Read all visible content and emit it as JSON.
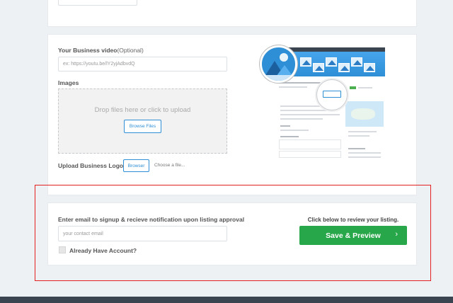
{
  "video_section": {
    "label": "Your Business video",
    "label_optional": "(Optional)",
    "placeholder": "ex: https://youtu.be/lY2yjAdbvdQ"
  },
  "images_section": {
    "label": "Images",
    "drop_text": "Drop files here or click to upload",
    "browse_label": "Browse Files"
  },
  "logo_section": {
    "label": "Upload Business Logo",
    "browser_label": "Browser",
    "choose_file": "Choose a file..."
  },
  "signup_section": {
    "label": "Enter email to signup & recieve notification upon listing approval",
    "email_placeholder": "your contact email",
    "already_account": "Already Have Account?"
  },
  "review_section": {
    "prompt": "Click below to review your listing.",
    "save_label": "Save & Preview",
    "chevron": "›"
  },
  "colors": {
    "accent_blue": "#2e8fd6",
    "save_green": "#27a74a",
    "highlight_red": "#e32020",
    "footer_dark": "#3a4450"
  }
}
